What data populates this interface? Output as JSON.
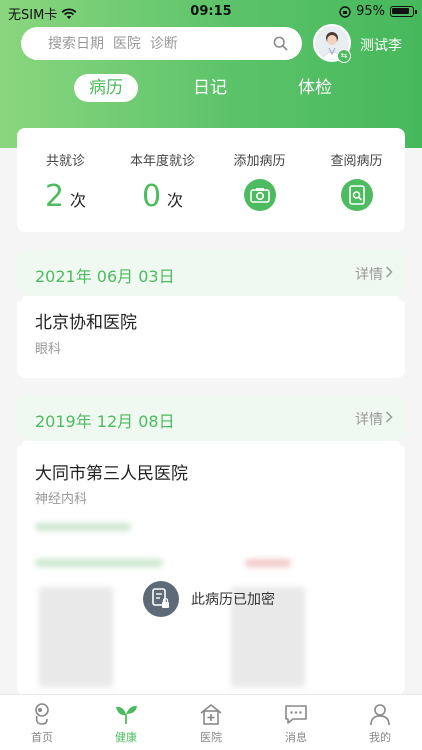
{
  "status_bar": {
    "carrier": "无SIM卡",
    "time": "09:15",
    "battery": "95%"
  },
  "search": {
    "placeholder": "搜索日期  医院  诊断"
  },
  "user": {
    "name": "测试李"
  },
  "tabs": [
    {
      "label": "病历",
      "active": true
    },
    {
      "label": "日记",
      "active": false
    },
    {
      "label": "体检",
      "active": false
    }
  ],
  "stats": {
    "total_label": "共就诊",
    "total_value": "2",
    "total_unit": "次",
    "year_label": "本年度就诊",
    "year_value": "0",
    "year_unit": "次",
    "add_label": "添加病历",
    "view_label": "查阅病历"
  },
  "records": [
    {
      "date": "2021年 06月 03日",
      "detail": "详情",
      "hospital": "北京协和医院",
      "dept": "眼科"
    },
    {
      "date": "2019年 12月 08日",
      "detail": "详情",
      "hospital": "大同市第三人民医院",
      "dept": "神经内科"
    }
  ],
  "encrypted_text": "此病历已加密",
  "bottom_nav": [
    {
      "label": "首页",
      "icon": "home-icon",
      "active": false
    },
    {
      "label": "健康",
      "icon": "sprout-icon",
      "active": true
    },
    {
      "label": "医院",
      "icon": "hospital-icon",
      "active": false
    },
    {
      "label": "消息",
      "icon": "message-icon",
      "active": false
    },
    {
      "label": "我的",
      "icon": "profile-icon",
      "active": false
    }
  ],
  "colors": {
    "accent": "#4dbb5f",
    "header_start": "#8ad67e",
    "header_end": "#46b85c"
  }
}
